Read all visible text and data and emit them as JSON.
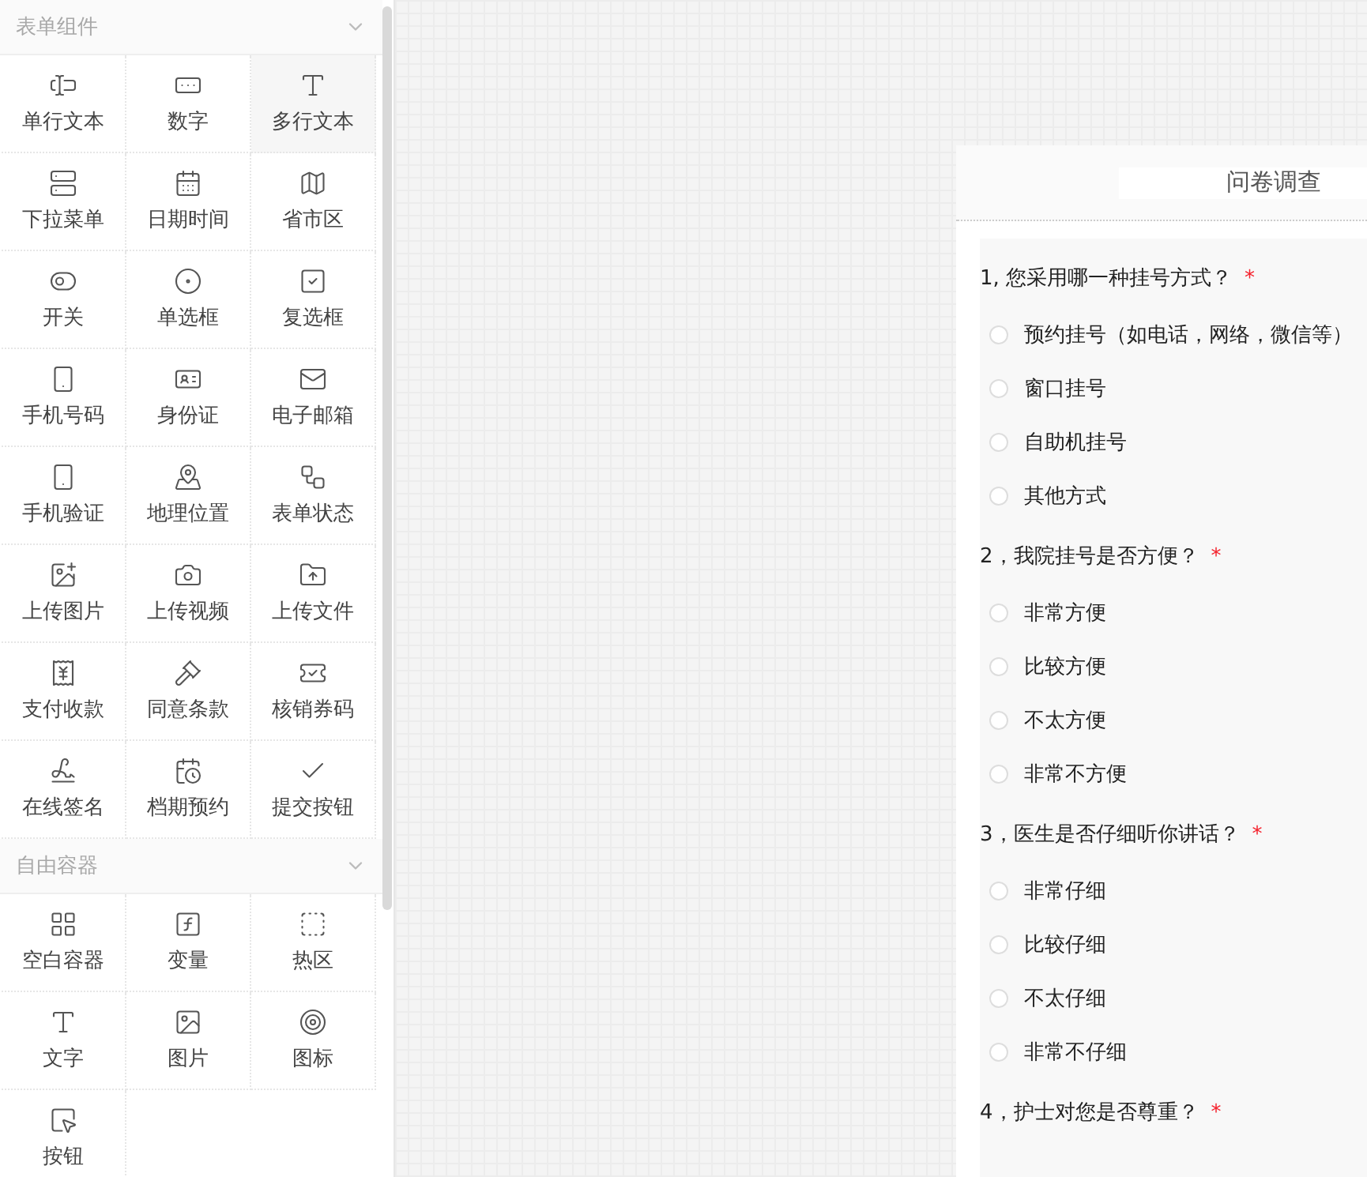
{
  "sidebar": {
    "sections": [
      {
        "title": "表单组件",
        "expanded": true,
        "items": [
          {
            "label": "单行文本",
            "selected": false
          },
          {
            "label": "数字",
            "selected": false
          },
          {
            "label": "多行文本",
            "selected": true
          },
          {
            "label": "下拉菜单",
            "selected": false
          },
          {
            "label": "日期时间",
            "selected": false
          },
          {
            "label": "省市区",
            "selected": false
          },
          {
            "label": "开关",
            "selected": false
          },
          {
            "label": "单选框",
            "selected": false
          },
          {
            "label": "复选框",
            "selected": false
          },
          {
            "label": "手机号码",
            "selected": false
          },
          {
            "label": "身份证",
            "selected": false
          },
          {
            "label": "电子邮箱",
            "selected": false
          },
          {
            "label": "手机验证",
            "selected": false
          },
          {
            "label": "地理位置",
            "selected": false
          },
          {
            "label": "表单状态",
            "selected": false
          },
          {
            "label": "上传图片",
            "selected": false
          },
          {
            "label": "上传视频",
            "selected": false
          },
          {
            "label": "上传文件",
            "selected": false
          },
          {
            "label": "支付收款",
            "selected": false
          },
          {
            "label": "同意条款",
            "selected": false
          },
          {
            "label": "核销券码",
            "selected": false
          },
          {
            "label": "在线签名",
            "selected": false
          },
          {
            "label": "档期预约",
            "selected": false
          },
          {
            "label": "提交按钮",
            "selected": false
          }
        ]
      },
      {
        "title": "自由容器",
        "expanded": true,
        "items": [
          {
            "label": "空白容器",
            "selected": false
          },
          {
            "label": "变量",
            "selected": false
          },
          {
            "label": "热区",
            "selected": false
          },
          {
            "label": "文字",
            "selected": false
          },
          {
            "label": "图片",
            "selected": false
          },
          {
            "label": "图标",
            "selected": false
          },
          {
            "label": "按钮",
            "selected": false
          }
        ]
      }
    ]
  },
  "form": {
    "title": "问卷调查",
    "questions": [
      {
        "title": "1, 您采用哪一种挂号方式？",
        "required_mark": "*",
        "options": [
          {
            "label": "预约挂号（如电话，网络，微信等）",
            "selected": false
          },
          {
            "label": "窗口挂号",
            "selected": false
          },
          {
            "label": "自助机挂号",
            "selected": false
          },
          {
            "label": "其他方式",
            "selected": false
          }
        ]
      },
      {
        "title": "2，我院挂号是否方便？",
        "required_mark": "*",
        "options": [
          {
            "label": "非常方便",
            "selected": false
          },
          {
            "label": "比较方便",
            "selected": false
          },
          {
            "label": "不太方便",
            "selected": false
          },
          {
            "label": "非常不方便",
            "selected": false
          }
        ]
      },
      {
        "title": "3，医生是否仔细听你讲话？",
        "required_mark": "*",
        "options": [
          {
            "label": "非常仔细",
            "selected": false
          },
          {
            "label": "比较仔细",
            "selected": false
          },
          {
            "label": "不太仔细",
            "selected": false
          },
          {
            "label": "非常不仔细",
            "selected": false
          }
        ]
      },
      {
        "title": "4，护士对您是否尊重？",
        "required_mark": "*"
      }
    ]
  }
}
